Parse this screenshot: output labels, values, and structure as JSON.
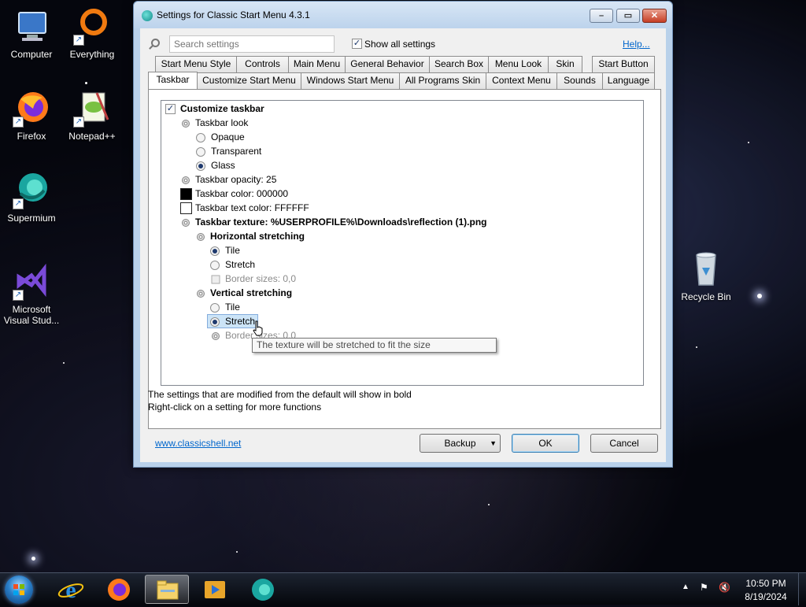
{
  "desktop": {
    "icons": [
      {
        "label": "Computer",
        "icon": "computer-icon"
      },
      {
        "label": "Everything",
        "icon": "everything-icon"
      },
      {
        "label": "Firefox",
        "icon": "firefox-icon"
      },
      {
        "label": "Notepad++",
        "icon": "notepad-plus-plus-icon"
      },
      {
        "label": "Supermium",
        "icon": "supermium-icon"
      },
      {
        "label": "Microsoft Visual Stud...",
        "icon": "visual-studio-icon"
      },
      {
        "label": "Recycle Bin",
        "icon": "recycle-bin-icon"
      }
    ]
  },
  "window": {
    "title": "Settings for Classic Start Menu 4.3.1",
    "search_placeholder": "Search settings",
    "show_all_label": "Show all settings",
    "show_all_checked": true,
    "help_label": "Help...",
    "tabs_row1": [
      "Start Menu Style",
      "Controls",
      "Main Menu",
      "General Behavior",
      "Search Box",
      "Menu Look",
      "Skin",
      "Start Button"
    ],
    "tabs_row2": [
      "Taskbar",
      "Customize Start Menu",
      "Windows Start Menu",
      "All Programs Skin",
      "Context Menu",
      "Sounds",
      "Language"
    ],
    "active_tab": "Taskbar",
    "settings": {
      "customize_taskbar": "Customize taskbar",
      "taskbar_look": "Taskbar look",
      "look_options": [
        "Opaque",
        "Transparent",
        "Glass"
      ],
      "look_selected": "Glass",
      "opacity": "Taskbar opacity: 25",
      "color": "Taskbar color: 000000",
      "text_color": "Taskbar text color: FFFFFF",
      "texture": "Taskbar texture: %USERPROFILE%\\Downloads\\reflection (1).png",
      "horizontal": "Horizontal stretching",
      "h_options": [
        "Tile",
        "Stretch"
      ],
      "h_selected": "Tile",
      "h_border": "Border sizes: 0,0",
      "vertical": "Vertical stretching",
      "v_options": [
        "Tile",
        "Stretch"
      ],
      "v_selected": "Stretch",
      "v_border": "Border sizes: 0,0",
      "color_swatch": "#000000",
      "text_color_swatch": "#FFFFFF"
    },
    "tooltip": "The texture will be stretched to fit the size",
    "note_line1": "The settings that are modified from the default will show in bold",
    "note_line2": "Right-click on a setting for more functions",
    "website": "www.classicshell.net",
    "backup_label": "Backup",
    "ok_label": "OK",
    "cancel_label": "Cancel"
  },
  "taskbar": {
    "apps": [
      "internet-explorer-icon",
      "firefox-icon",
      "file-explorer-icon",
      "media-player-icon",
      "supermium-icon"
    ],
    "active_app": "file-explorer-icon",
    "time": "10:50 PM",
    "date": "8/19/2024"
  }
}
